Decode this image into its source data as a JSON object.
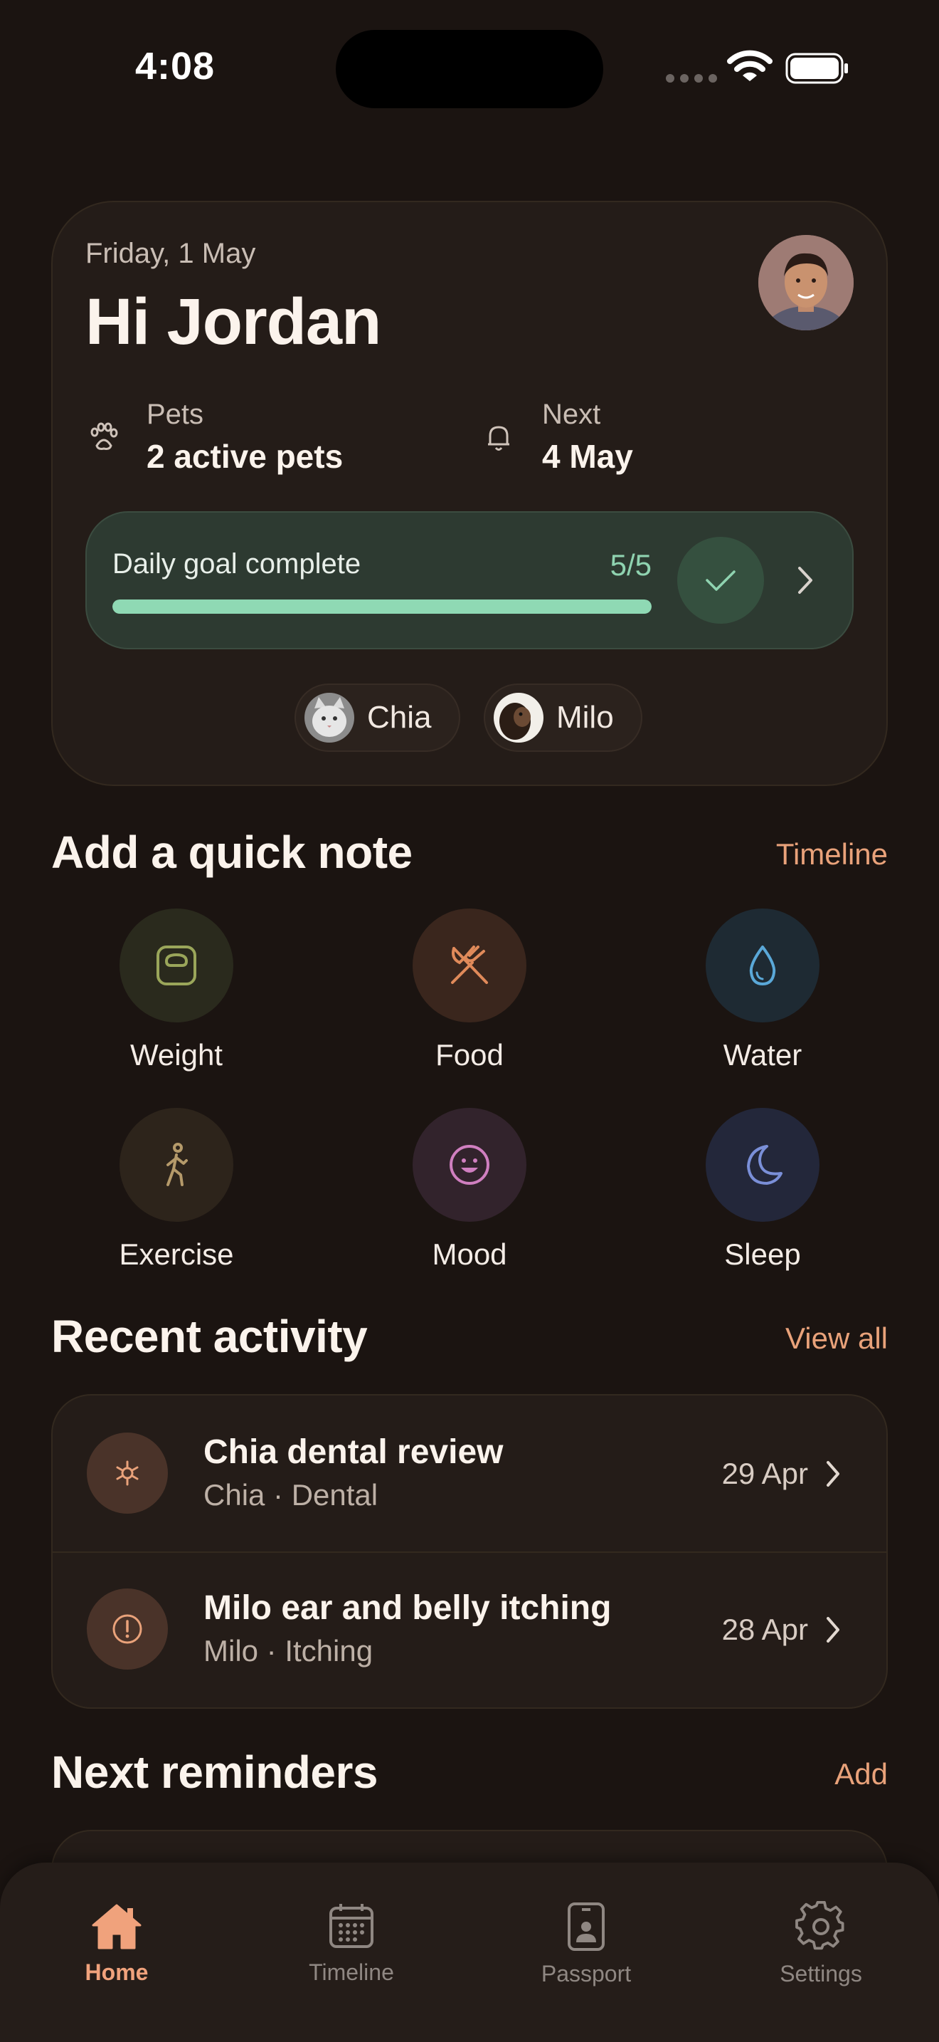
{
  "status_bar": {
    "time": "4:08"
  },
  "hero": {
    "date": "Friday, 1 May",
    "greeting": "Hi Jordan",
    "stats": [
      {
        "icon": "paw-icon",
        "label": "Pets",
        "value": "2 active pets"
      },
      {
        "icon": "bell-icon",
        "label": "Next",
        "value": "4 May"
      }
    ],
    "goal": {
      "title": "Daily goal complete",
      "count": "5/5",
      "progress": 1.0
    },
    "pets": [
      {
        "name": "Chia"
      },
      {
        "name": "Milo"
      }
    ]
  },
  "quick_note": {
    "title": "Add a quick note",
    "link": "Timeline",
    "items": [
      {
        "label": "Weight",
        "icon": "scale-icon",
        "color": "#9aa65a"
      },
      {
        "label": "Food",
        "icon": "fork-knife-icon",
        "color": "#e08a5a"
      },
      {
        "label": "Water",
        "icon": "water-drop-icon",
        "color": "#5aa8d8"
      },
      {
        "label": "Exercise",
        "icon": "walking-icon",
        "color": "#b59a6a"
      },
      {
        "label": "Mood",
        "icon": "smile-icon",
        "color": "#d07fc0"
      },
      {
        "label": "Sleep",
        "icon": "moon-icon",
        "color": "#7a8fd8"
      }
    ]
  },
  "recent": {
    "title": "Recent activity",
    "link": "View all",
    "items": [
      {
        "title": "Chia dental review",
        "subtitle": "Chia · Dental",
        "date": "29 Apr",
        "icon": "asterisk-icon"
      },
      {
        "title": "Milo ear and belly itching",
        "subtitle": "Milo · Itching",
        "date": "28 Apr",
        "icon": "alert-circle-icon"
      }
    ]
  },
  "reminders": {
    "title": "Next reminders",
    "link": "Add"
  },
  "tabs": [
    {
      "label": "Home",
      "icon": "home-icon",
      "active": true
    },
    {
      "label": "Timeline",
      "icon": "calendar-icon",
      "active": false
    },
    {
      "label": "Passport",
      "icon": "passport-icon",
      "active": false
    },
    {
      "label": "Settings",
      "icon": "gear-icon",
      "active": false
    }
  ],
  "colors": {
    "accent": "#e9a27a",
    "goal_green": "#8fd9b4",
    "background": "#1b1411"
  }
}
